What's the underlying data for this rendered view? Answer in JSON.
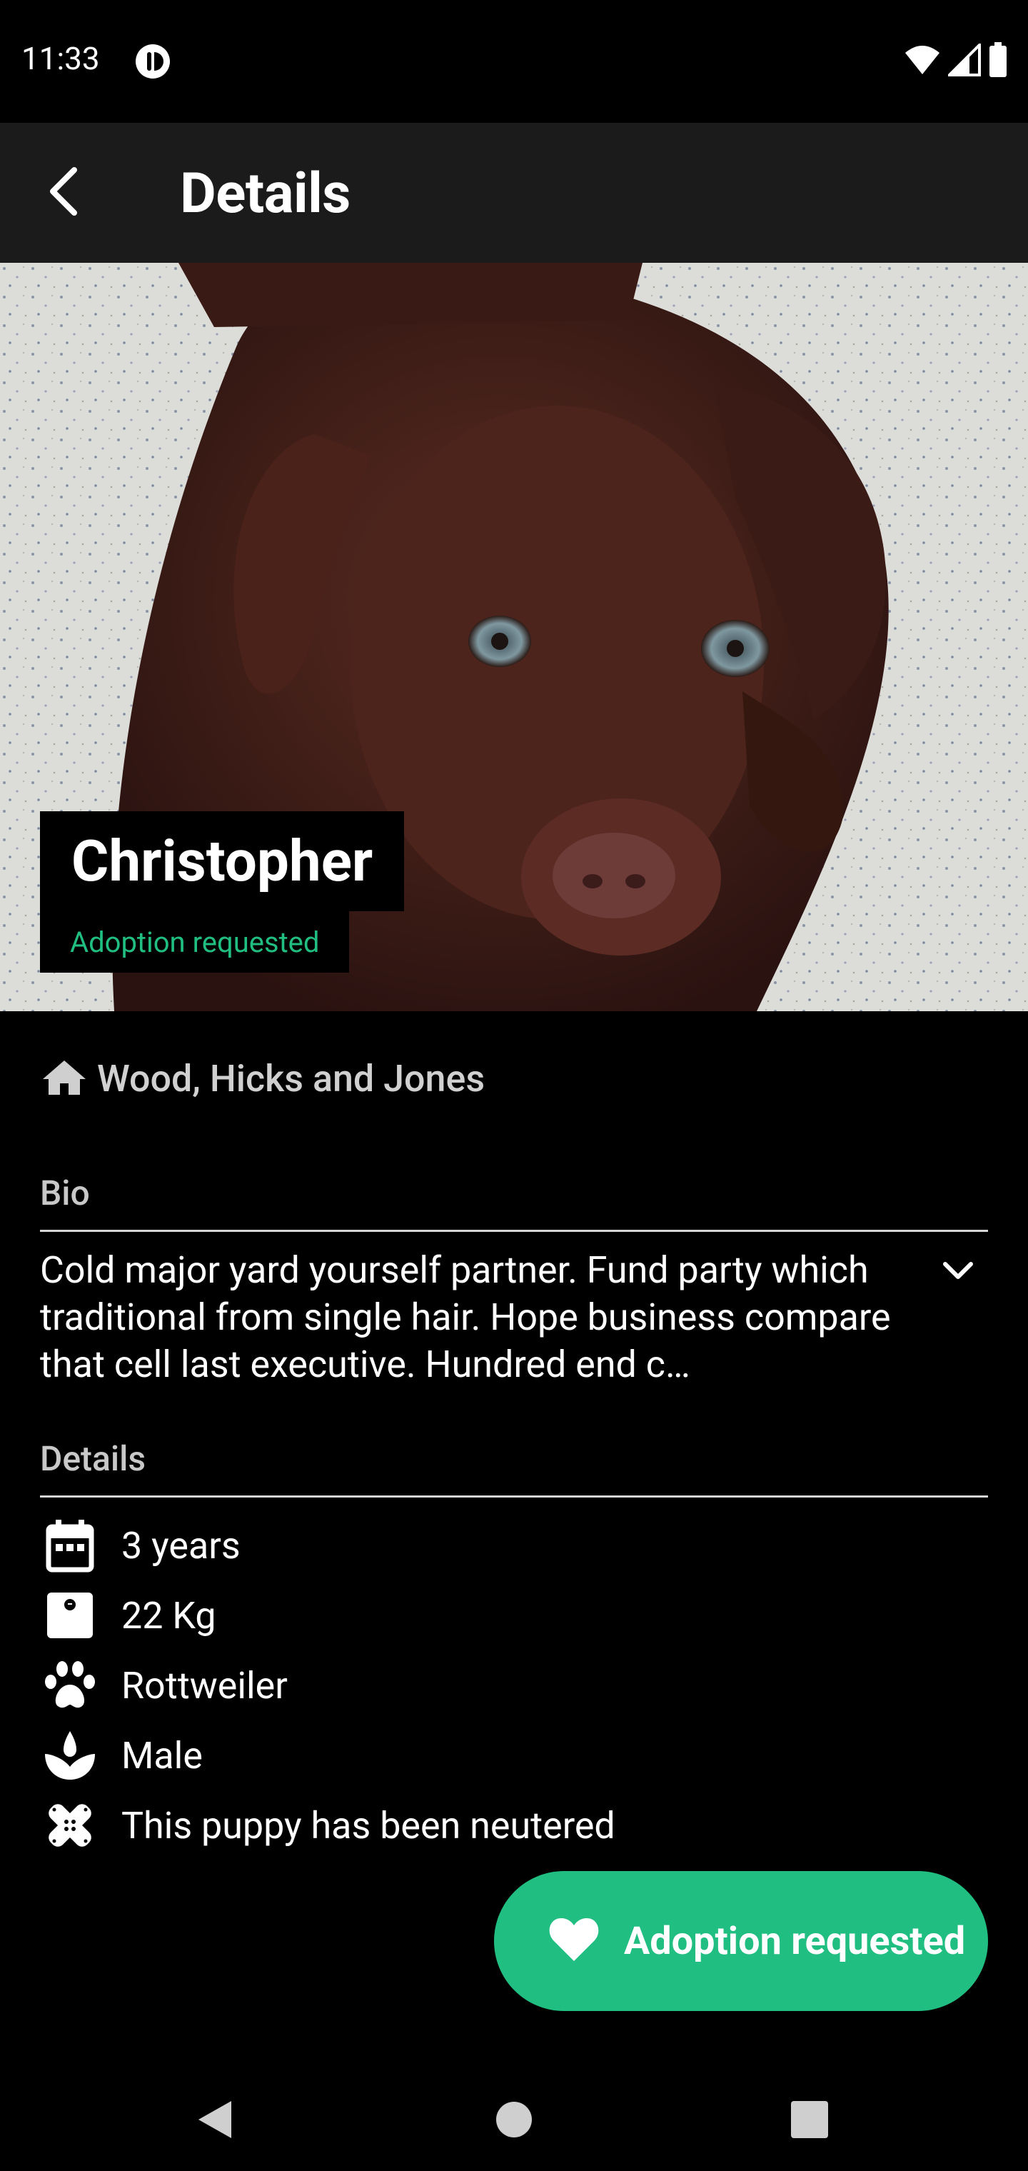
{
  "status_bar": {
    "time": "11:33",
    "icons": [
      "app-notification-icon",
      "wifi-icon",
      "signal-icon",
      "battery-icon"
    ]
  },
  "app_bar": {
    "title": "Details",
    "back_icon": "arrow-back-icon"
  },
  "pet": {
    "name": "Christopher",
    "status": "Adoption requested",
    "photo_description": "chocolate labrador puppy"
  },
  "shelter": {
    "icon": "home-icon",
    "name": "Wood, Hicks and Jones"
  },
  "bio": {
    "title": "Bio",
    "text": "Cold major yard yourself partner. Fund party which traditional from single hair. Hope business compare that cell last executive. Hundred end c…",
    "expand_icon": "chevron-down-icon"
  },
  "details": {
    "title": "Details",
    "items": [
      {
        "icon": "calendar-icon",
        "text": "3 years"
      },
      {
        "icon": "weight-icon",
        "text": "22 Kg"
      },
      {
        "icon": "paw-icon",
        "text": "Rottweiler"
      },
      {
        "icon": "gender-icon",
        "text": "Male"
      },
      {
        "icon": "bandage-icon",
        "text": "This puppy has been neutered"
      }
    ]
  },
  "fab": {
    "icon": "heart-icon",
    "label": "Adoption requested"
  },
  "colors": {
    "accent": "#20bf81",
    "app_bar": "#1b1b1b",
    "background": "#000000"
  }
}
